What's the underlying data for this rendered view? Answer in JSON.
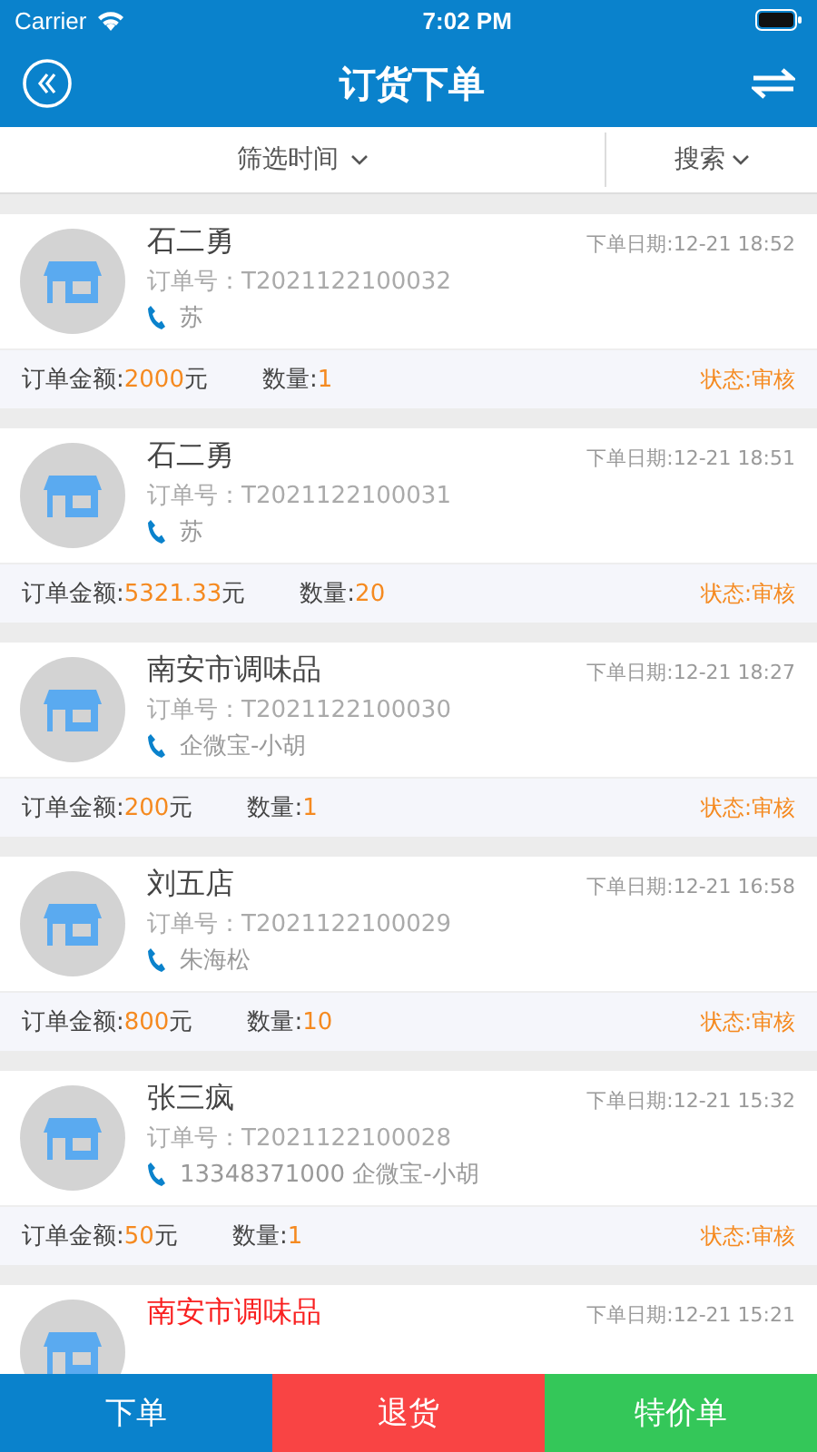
{
  "status_bar": {
    "carrier": "Carrier",
    "time": "7:02 PM"
  },
  "nav": {
    "title": "订货下单"
  },
  "filter": {
    "time_filter": "筛选时间",
    "search": "搜索"
  },
  "orders": [
    {
      "name": "石二勇",
      "highlight": false,
      "date": "下单日期:12-21 18:52",
      "order_no": "订单号：T2021122100032",
      "contact": "苏",
      "amount_label": "订单金额:",
      "amount": "2000",
      "unit": "元",
      "qty_label": "数量:",
      "qty": "1",
      "status": "状态:审核"
    },
    {
      "name": "石二勇",
      "highlight": false,
      "date": "下单日期:12-21 18:51",
      "order_no": "订单号：T2021122100031",
      "contact": "苏",
      "amount_label": "订单金额:",
      "amount": "5321.33",
      "unit": "元",
      "qty_label": "数量:",
      "qty": "20",
      "status": "状态:审核"
    },
    {
      "name": "南安市调味品",
      "highlight": false,
      "date": "下单日期:12-21 18:27",
      "order_no": "订单号：T2021122100030",
      "contact": "企微宝-小胡",
      "amount_label": "订单金额:",
      "amount": "200",
      "unit": "元",
      "qty_label": "数量:",
      "qty": "1",
      "status": "状态:审核"
    },
    {
      "name": "刘五店",
      "highlight": false,
      "date": "下单日期:12-21 16:58",
      "order_no": "订单号：T2021122100029",
      "contact": "朱海松",
      "amount_label": "订单金额:",
      "amount": "800",
      "unit": "元",
      "qty_label": "数量:",
      "qty": "10",
      "status": "状态:审核"
    },
    {
      "name": "张三疯",
      "highlight": false,
      "date": "下单日期:12-21 15:32",
      "order_no": "订单号：T2021122100028",
      "contact": "13348371000 企微宝-小胡",
      "amount_label": "订单金额:",
      "amount": "50",
      "unit": "元",
      "qty_label": "数量:",
      "qty": "1",
      "status": "状态:审核"
    },
    {
      "name": "南安市调味品",
      "highlight": true,
      "date": "下单日期:12-21 15:21"
    }
  ],
  "bottom_tabs": [
    {
      "label": "下单",
      "kind": "order"
    },
    {
      "label": "退货",
      "kind": "return"
    },
    {
      "label": "特价单",
      "kind": "special"
    }
  ]
}
